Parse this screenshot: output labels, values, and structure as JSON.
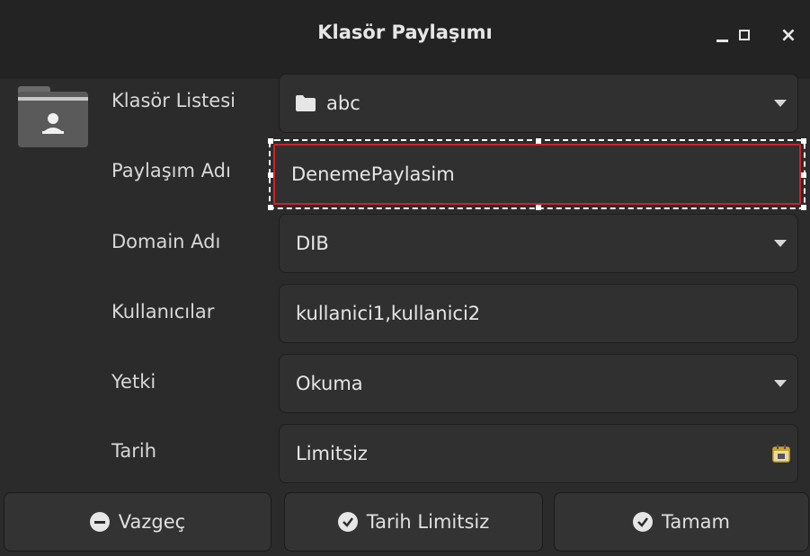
{
  "window": {
    "title": "Klasör Paylaşımı",
    "controls": {
      "minimize": "minimize-icon",
      "maximize": "maximize-icon",
      "close": "×"
    }
  },
  "form": {
    "folder_list": {
      "label": "Klasör Listesi",
      "value": "abc",
      "icon": "folder-icon"
    },
    "share_name": {
      "label": "Paylaşım Adı",
      "value": "DenemePaylasim"
    },
    "domain_name": {
      "label": "Domain Adı",
      "value": "DIB"
    },
    "users": {
      "label": "Kullanıcılar",
      "value": "kullanici1,kullanici2"
    },
    "permission": {
      "label": "Yetki",
      "value": "Okuma"
    },
    "date": {
      "label": "Tarih",
      "value": "Limitsiz",
      "icon": "calendar-icon"
    }
  },
  "buttons": {
    "cancel": {
      "label": "Vazgeç",
      "icon": "minus-circle-icon"
    },
    "date_unlimited": {
      "label": "Tarih Limitsiz",
      "icon": "check-circle-icon"
    },
    "ok": {
      "label": "Tamam",
      "icon": "check-circle-icon"
    }
  },
  "colors": {
    "background": "#2b2b2b",
    "titlebar": "#232323",
    "focus_border": "#d0202a",
    "calendar_accent": "#c9a227"
  }
}
